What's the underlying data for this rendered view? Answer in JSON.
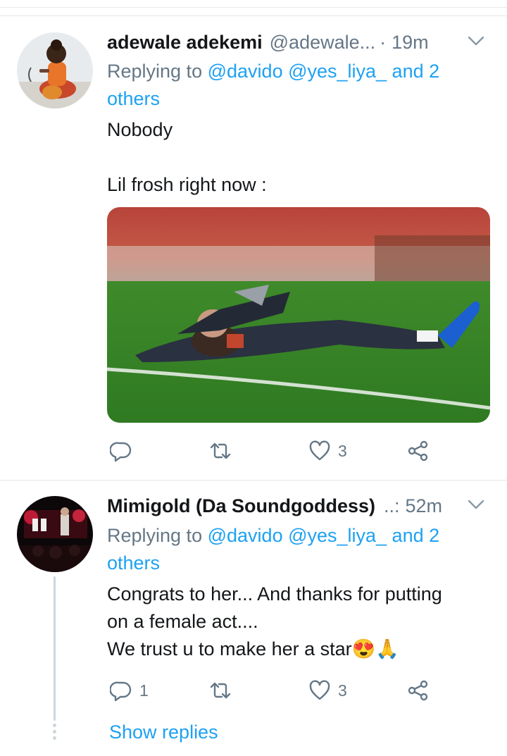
{
  "tweets": [
    {
      "display_name": "adewale adekemi",
      "handle": "@adewale...",
      "separator": "·",
      "time": "19m",
      "replying_prefix": "Replying to",
      "replying_mentions": "@davido @yes_liya_ and 2",
      "replying_others": "others",
      "text_line_1": "Nobody",
      "text_line_2": "Lil frosh right now :",
      "actions": {
        "replies": "",
        "retweets": "",
        "likes": "3"
      }
    },
    {
      "display_name": "Mimigold (Da Soundgoddess)",
      "separator": "..:",
      "time": "52m",
      "replying_prefix": "Replying to",
      "replying_mentions": "@davido @yes_liya_ and 2",
      "replying_others": "others",
      "text_line_1": "Congrats to her... And thanks for putting",
      "text_line_2": "on a female act....",
      "text_line_3": "We trust u to make her a star",
      "emoji": "😍🙏",
      "actions": {
        "replies": "1",
        "retweets": "",
        "likes": "3"
      }
    }
  ],
  "show_replies_label": "Show replies",
  "icons": [
    "reply-icon",
    "retweet-icon",
    "like-icon",
    "share-icon",
    "chevron-down-icon"
  ],
  "colors": {
    "link": "#1da1f2",
    "muted": "#657786",
    "text": "#14171a",
    "divider": "#e1e8ed"
  }
}
